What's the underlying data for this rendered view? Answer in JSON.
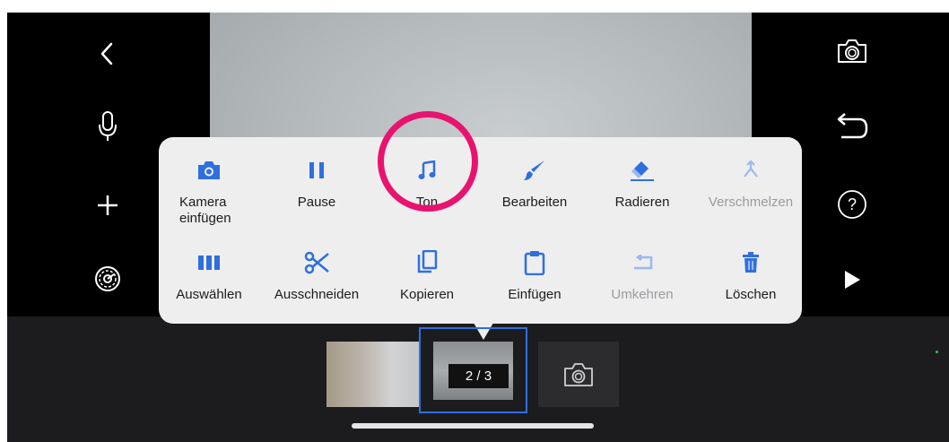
{
  "left_toolbar": {
    "back": {
      "icon": "chevron-left-icon"
    },
    "mic": {
      "icon": "microphone-icon"
    },
    "add": {
      "icon": "plus-icon"
    },
    "settings": {
      "icon": "settings-icon"
    }
  },
  "right_toolbar": {
    "camera": {
      "icon": "camera-icon"
    },
    "undo": {
      "icon": "undo-icon"
    },
    "help": {
      "icon": "help-icon",
      "label": "?"
    },
    "play": {
      "icon": "play-icon"
    }
  },
  "menu": {
    "row1": [
      {
        "label": "Kamera einfügen",
        "icon": "camera-icon",
        "enabled": true
      },
      {
        "label": "Pause",
        "icon": "pause-icon",
        "enabled": true
      },
      {
        "label": "Ton",
        "icon": "music-note-icon",
        "enabled": true,
        "highlighted": true
      },
      {
        "label": "Bearbeiten",
        "icon": "brush-icon",
        "enabled": true
      },
      {
        "label": "Radieren",
        "icon": "eraser-icon",
        "enabled": true
      },
      {
        "label": "Verschmelzen",
        "icon": "merge-icon",
        "enabled": false
      }
    ],
    "row2": [
      {
        "label": "Auswählen",
        "icon": "select-icon",
        "enabled": true
      },
      {
        "label": "Ausschneiden",
        "icon": "scissors-icon",
        "enabled": true
      },
      {
        "label": "Kopieren",
        "icon": "copy-icon",
        "enabled": true
      },
      {
        "label": "Einfügen",
        "icon": "paste-icon",
        "enabled": true
      },
      {
        "label": "Umkehren",
        "icon": "reverse-icon",
        "enabled": false
      },
      {
        "label": "Löschen",
        "icon": "trash-icon",
        "enabled": true
      }
    ]
  },
  "timeline": {
    "current_frame_label": "2 / 3",
    "frames": [
      {
        "name": "frame-1"
      },
      {
        "name": "frame-2",
        "selected": true
      },
      {
        "name": "add-frame-camera",
        "icon": "camera-icon"
      }
    ]
  },
  "colors": {
    "accent": "#2f6fe0",
    "highlight_ring": "#e8136f",
    "disabled": "#9bb8ee",
    "menu_bg": "#eeeeef"
  }
}
